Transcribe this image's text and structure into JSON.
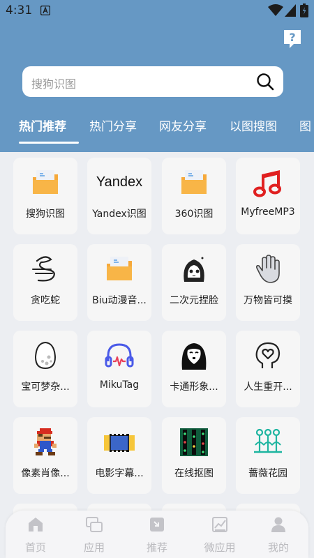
{
  "status_bar": {
    "time": "4:31",
    "notif_icon": "a-letter-icon"
  },
  "search": {
    "placeholder": "搜狗识图"
  },
  "tabs": [
    "热门推荐",
    "热门分享",
    "网友分享",
    "以图搜图",
    "图"
  ],
  "active_tab": "热门推荐",
  "apps": [
    {
      "label": "搜狗识图",
      "icon": "folder-icon"
    },
    {
      "label": "Yandex识图",
      "icon": "yandex-logo",
      "logo_text": "Yandex"
    },
    {
      "label": "360识图",
      "icon": "folder-icon"
    },
    {
      "label": "MyfreeMP3",
      "icon": "music-note-icon"
    },
    {
      "label": "贪吃蛇",
      "icon": "snake-icon"
    },
    {
      "label": "Biu动漫音...",
      "icon": "folder-icon"
    },
    {
      "label": "二次元捏脸",
      "icon": "anime-face-icon"
    },
    {
      "label": "万物皆可摸",
      "icon": "hand-icon"
    },
    {
      "label": "宝可梦杂...",
      "icon": "egg-icon"
    },
    {
      "label": "MikuTag",
      "icon": "headphones-icon"
    },
    {
      "label": "卡通形象...",
      "icon": "ghost-mask-icon"
    },
    {
      "label": "人生重开...",
      "icon": "head-heart-icon"
    },
    {
      "label": "像素肖像...",
      "icon": "pixel-mario-icon"
    },
    {
      "label": "电影字幕...",
      "icon": "film-strip-icon"
    },
    {
      "label": "在线抠图",
      "icon": "circuit-icon"
    },
    {
      "label": "蔷薇花园",
      "icon": "garden-icon"
    }
  ],
  "bottom_nav": [
    {
      "label": "首页",
      "icon": "home-icon"
    },
    {
      "label": "应用",
      "icon": "apps-icon"
    },
    {
      "label": "推荐",
      "icon": "recommend-icon"
    },
    {
      "label": "微应用",
      "icon": "chart-icon"
    },
    {
      "label": "我的",
      "icon": "user-icon"
    }
  ],
  "colors": {
    "header": "#6698c4",
    "card": "#f6f6f6",
    "background": "#eceef2",
    "nav_inactive": "#b9b9bd"
  }
}
